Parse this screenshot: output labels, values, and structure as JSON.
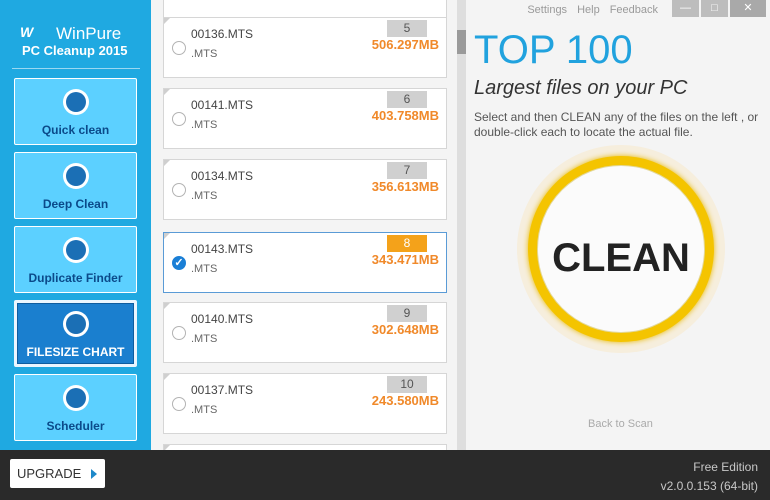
{
  "app": {
    "brand_mark": "W",
    "brand_name": "WinPure",
    "product_name": "PC Cleanup 2015"
  },
  "sidebar": {
    "items": [
      {
        "label": "Quick clean",
        "icon": "wand-icon"
      },
      {
        "label": "Deep Clean",
        "icon": "speedometer-icon"
      },
      {
        "label": "Duplicate Finder",
        "icon": "duplicate-icon"
      },
      {
        "label": "FILESIZE CHART",
        "icon": "chart-icon",
        "active": true
      },
      {
        "label": "Scheduler",
        "icon": "calendar-icon"
      }
    ]
  },
  "files": [
    {
      "name": "00136.MTS",
      "ext": ".MTS",
      "rank": "5",
      "size": "506.297MB"
    },
    {
      "name": "00141.MTS",
      "ext": ".MTS",
      "rank": "6",
      "size": "403.758MB"
    },
    {
      "name": "00134.MTS",
      "ext": ".MTS",
      "rank": "7",
      "size": "356.613MB"
    },
    {
      "name": "00143.MTS",
      "ext": ".MTS",
      "rank": "8",
      "size": "343.471MB",
      "selected": true
    },
    {
      "name": "00140.MTS",
      "ext": ".MTS",
      "rank": "9",
      "size": "302.648MB"
    },
    {
      "name": "00137.MTS",
      "ext": ".MTS",
      "rank": "10",
      "size": "243.580MB"
    }
  ],
  "header_links": {
    "settings": "Settings",
    "help": "Help",
    "feedback": "Feedback"
  },
  "window_controls": {
    "minimize": "—",
    "maximize": "□",
    "close": "✕"
  },
  "panel": {
    "title": "TOP 100",
    "subtitle": "Largest files on your PC",
    "description": "Select and then CLEAN any of the files on the left , or double-click each to locate the actual file.",
    "clean_label": "CLEAN",
    "back_label": "Back to Scan",
    "selected_check": "✓"
  },
  "footer": {
    "upgrade_label": "UPGRADE",
    "edition": "Free Edition",
    "version": "v2.0.0.153 (64-bit)"
  },
  "colors": {
    "sidebar": "#1fa9e1",
    "accent_blue": "#21a2de",
    "size_orange": "#f0892a",
    "rank_selected": "#f4a21a",
    "clean_ring": "#f4c400"
  }
}
